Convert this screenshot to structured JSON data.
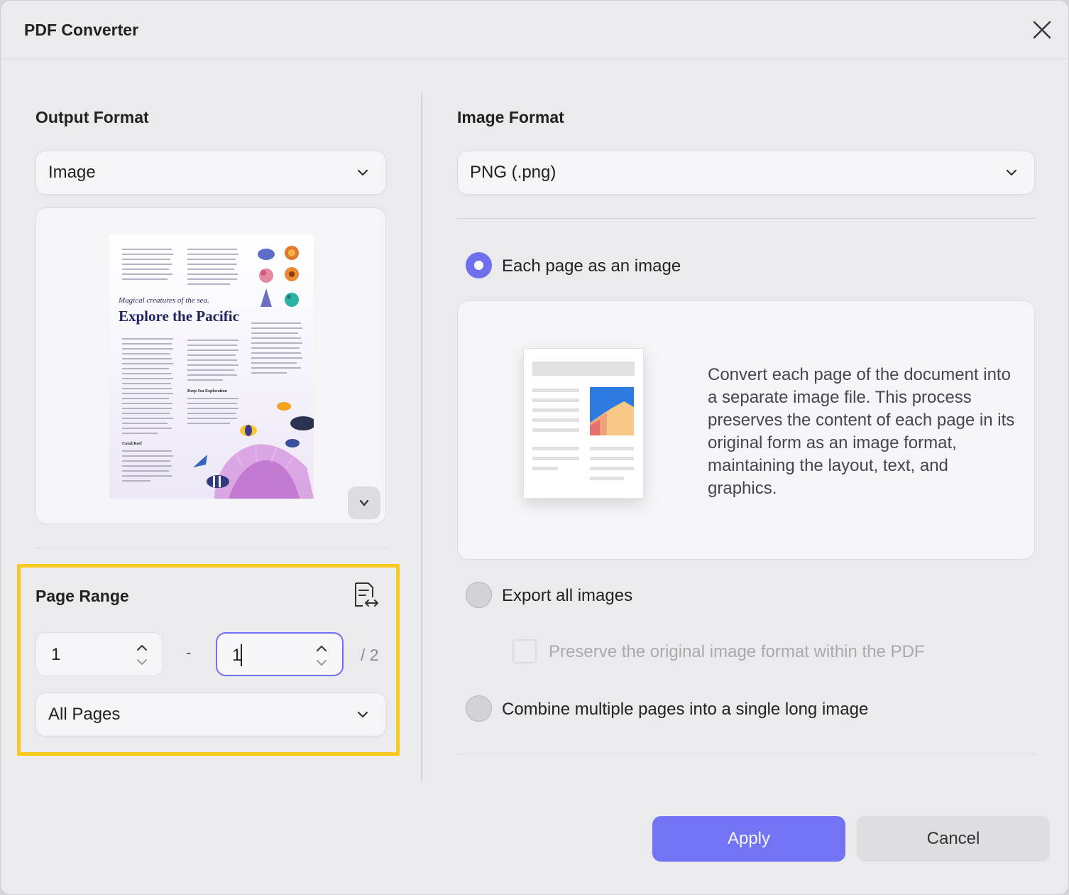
{
  "window": {
    "title": "PDF Converter"
  },
  "output_format": {
    "heading": "Output Format",
    "selected": "Image"
  },
  "preview": {
    "subtitle": "Magical creatures of the sea.",
    "heading": "Explore the Pacific",
    "subheads": [
      "Deep Sea Exploration",
      "Coral Reef"
    ]
  },
  "page_range": {
    "heading": "Page Range",
    "from": "1",
    "to": "1",
    "separator": "-",
    "total": "/ 2",
    "scope": "All Pages"
  },
  "image_format": {
    "heading": "Image Format",
    "selected": "PNG (.png)"
  },
  "options": {
    "each_page": {
      "label": "Each page as an image",
      "selected": true
    },
    "description": "Convert each page of the document into a separate image file. This process preserves the content of each page in its original form as an image format, maintaining the layout, text, and graphics.",
    "export_all": {
      "label": "Export all images",
      "selected": false
    },
    "preserve": {
      "label": "Preserve the original image format within the PDF",
      "checked": false,
      "disabled": true
    },
    "combine": {
      "label": "Combine multiple pages into a single long image",
      "selected": false
    }
  },
  "buttons": {
    "apply": "Apply",
    "cancel": "Cancel"
  },
  "colors": {
    "accent": "#6e70f0",
    "highlight": "#f8c81b",
    "apply_bg": "#7374f4"
  },
  "icons": {
    "close": "close-icon",
    "dropdown": "chevron-down-icon",
    "swap": "document-swap-icon",
    "stepper": "stepper-icon"
  }
}
